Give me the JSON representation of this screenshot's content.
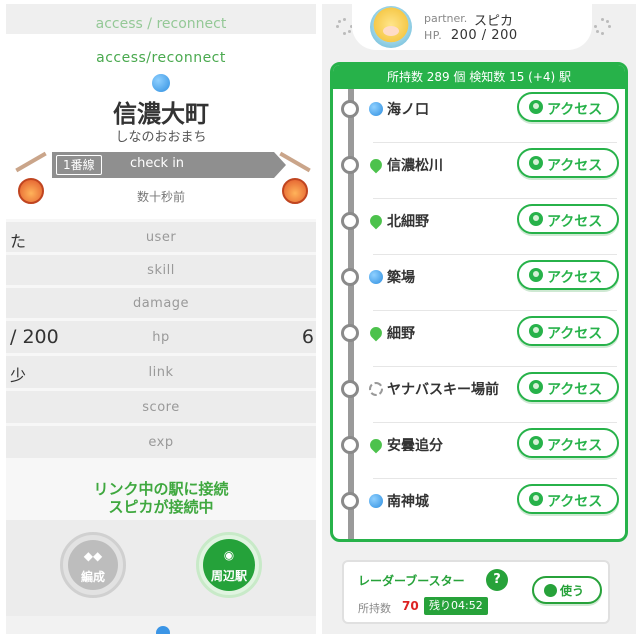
{
  "left": {
    "top_strip": "access / reconnect",
    "access_title": "access/reconnect",
    "station_name": "信濃大町",
    "station_kana": "しなのおおまち",
    "line_badge": "1番線",
    "checkin_label": "check in",
    "time_ago": "数十秒前",
    "stats": [
      {
        "label": "user",
        "left": "た",
        "right": ""
      },
      {
        "label": "skill",
        "left": "",
        "right": ""
      },
      {
        "label": "damage",
        "left": "",
        "right": ""
      },
      {
        "label": "hp",
        "left": "/ 200",
        "right": "6"
      },
      {
        "label": "link",
        "left": "少",
        "right": ""
      },
      {
        "label": "score",
        "left": "",
        "right": ""
      },
      {
        "label": "exp",
        "left": "",
        "right": ""
      }
    ],
    "link_message_1": "リンク中の駅に接続",
    "link_message_2": "スピカが接続中",
    "nav": {
      "formation_label": "編成",
      "nearby_label": "周辺駅"
    }
  },
  "right": {
    "partner": {
      "label": "partner.",
      "name": "スピカ",
      "hp_key": "HP.",
      "hp_value": "200 / 200"
    },
    "list_header": "所持数 289 個 検知数 15 (+4) 駅",
    "access_label": "アクセス",
    "stations": [
      {
        "name": "海ノ口",
        "icon": "blue-orb-icon"
      },
      {
        "name": "信濃松川",
        "icon": "green-leaf-icon"
      },
      {
        "name": "北細野",
        "icon": "green-leaf-icon"
      },
      {
        "name": "簗場",
        "icon": "blue-orb-icon"
      },
      {
        "name": "細野",
        "icon": "green-leaf-icon"
      },
      {
        "name": "ヤナバスキー場前",
        "icon": "empty-ring-icon"
      },
      {
        "name": "安曇追分",
        "icon": "green-leaf-icon"
      },
      {
        "name": "南神城",
        "icon": "blue-orb-icon"
      }
    ],
    "radar": {
      "title": "レーダーブースター",
      "help": "?",
      "owned_label": "所持数",
      "owned_count": "70",
      "remaining": "残り04:52",
      "use_label": "使う"
    }
  },
  "colors": {
    "accent_green": "#27b24a",
    "station_blue": "#2f8fe0",
    "owned_red": "#dd2222"
  }
}
